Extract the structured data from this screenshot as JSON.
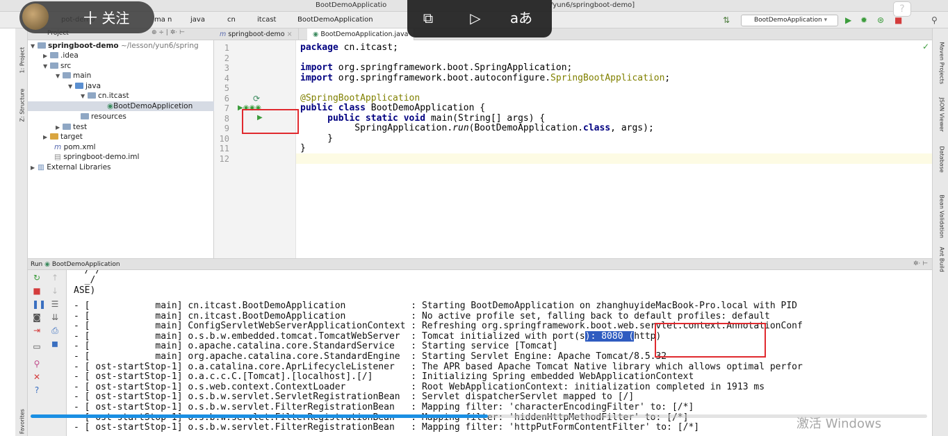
{
  "titlebar": {
    "file_tab": "BootDemoApplicatio",
    "path": "/yun6/springboot-demo]"
  },
  "navbar": {
    "crumbs": [
      "s",
      "pot-demo",
      "ma n",
      "java",
      "cn",
      "itcast",
      "BootDemoApplication"
    ],
    "run_config": "BootDemoApplication"
  },
  "overlay": {
    "follow_label": "十 关注",
    "help_label": "?"
  },
  "left_strip": {
    "project_tab": "1: Project",
    "structure_tab": "Z: Structure",
    "favorites_tab": "2: Favorites"
  },
  "right_strip": {
    "tabs": [
      "Maven Projects",
      "JSON Viewer",
      "Database",
      "Bean Validation",
      "Ant Build"
    ]
  },
  "project_panel": {
    "header": "Project",
    "tree": [
      {
        "label": "springboot-demo",
        "suffix": "~/lesson/yun6/spring",
        "indent": 0
      },
      {
        "label": ".idea",
        "indent": 1
      },
      {
        "label": "src",
        "indent": 1
      },
      {
        "label": "main",
        "indent": 2
      },
      {
        "label": "java",
        "indent": 3
      },
      {
        "label": "cn.itcast",
        "indent": 4
      },
      {
        "label": "BootDemoApplicetion",
        "indent": 5
      },
      {
        "label": "resources",
        "indent": 3
      },
      {
        "label": "test",
        "indent": 2
      },
      {
        "label": "target",
        "indent": 1
      },
      {
        "label": "pom.xml",
        "indent": 1
      },
      {
        "label": "springboot-demo.iml",
        "indent": 1
      },
      {
        "label": "External Libraries",
        "indent": 0
      }
    ]
  },
  "editor": {
    "tabs": [
      "springboot-demo",
      "BootDemoApplication.java"
    ],
    "line_numbers": [
      "1",
      "2",
      "3",
      "4",
      "5",
      "6",
      "7",
      "8",
      "9",
      "10",
      "11",
      "12"
    ],
    "lines": [
      {
        "kw": "package",
        "rest": " cn.itcast;"
      },
      {
        "kw": "",
        "rest": ""
      },
      {
        "kw": "import",
        "rest": " org.springframework.boot.SpringApplication;"
      },
      {
        "kw": "import",
        "rest": " org.springframework.boot.autoconfigure.",
        "ann": "SpringBootApplication",
        "tail": ";"
      },
      {
        "kw": "",
        "rest": ""
      },
      {
        "ann": "@SpringBootApplication"
      },
      {
        "kw": "public class",
        "rest": " BootDemoApplication {"
      },
      {
        "indent": "     ",
        "kw": "public static void",
        "rest": " main(String[] args) {"
      },
      {
        "indent": "          ",
        "rest": "SpringApplication.",
        "it": "run",
        "tail": "(BootDemoApplication.",
        "kw2": "class",
        "tail2": ", args);"
      },
      {
        "indent": "     ",
        "rest": "}"
      },
      {
        "rest": "}"
      },
      {
        "rest": ""
      }
    ]
  },
  "run_panel": {
    "header_run": "Run",
    "header_config": "BootDemoApplication",
    "pre_lines": [
      "  / /",
      "  _/",
      "ASE)"
    ],
    "log_rows": [
      {
        "dash": "- [",
        "thread": "           main]",
        "logger": "cn.itcast.BootDemoApplication           ",
        "msg": "Starting BootDemoApplication on zhanghuyideMacBook-Pro.local with PID"
      },
      {
        "dash": "- [",
        "thread": "           main]",
        "logger": "cn.itcast.BootDemoApplication           ",
        "msg": "No active profile set, falling back to default profiles: default"
      },
      {
        "dash": "- [",
        "thread": "           main]",
        "logger": "ConfigServletWebServerApplicationContext",
        "msg": "Refreshing org.springframework.boot.web.servlet.context.AnnotationConf"
      },
      {
        "dash": "- [",
        "thread": "           main]",
        "logger": "o.s.b.w.embedded.tomcat.TomcatWebServer ",
        "msg_pre": "Tomcat initialized with port(s",
        "msg_hl": "): 8080 (",
        "msg_post": "http)"
      },
      {
        "dash": "- [",
        "thread": "           main]",
        "logger": "o.apache.catalina.core.StandardService  ",
        "msg": "Starting service [Tomcat]"
      },
      {
        "dash": "- [",
        "thread": "           main]",
        "logger": "org.apache.catalina.core.StandardEngine ",
        "msg": "Starting Servlet Engine: Apache Tomcat/8.5.32"
      },
      {
        "dash": "- [",
        "thread": "ost-startStop-1]",
        "logger": "o.a.catalina.core.AprLifecycleListener  ",
        "msg": "The APR based Apache Tomcat Native library which allows optimal perfor"
      },
      {
        "dash": "- [",
        "thread": "ost-startStop-1]",
        "logger": "o.a.c.c.C.[Tomcat].[localhost].[/]      ",
        "msg": "Initializing Spring embedded WebApplicationContext"
      },
      {
        "dash": "- [",
        "thread": "ost-startStop-1]",
        "logger": "o.s.web.context.ContextLoader           ",
        "msg": "Root WebApplicationContext: initialization completed in 1913 ms"
      },
      {
        "dash": "- [",
        "thread": "ost-startStop-1]",
        "logger": "o.s.b.w.servlet.ServletRegistrationBean ",
        "msg": "Servlet dispatcherServlet mapped to [/]"
      },
      {
        "dash": "- [",
        "thread": "ost-startStop-1]",
        "logger": "o.s.b.w.servlet.FilterRegistrationBean  ",
        "msg": "Mapping filter: 'characterEncodingFilter' to: [/*]"
      },
      {
        "dash": "- [",
        "thread": "ost-startStop-1]",
        "logger": "o.s.b.w.servlet.FilterRegistrationBean  ",
        "msg": "Mapping filter: 'hiddenHttpMethodFilter' to: [/*]"
      },
      {
        "dash": "- [",
        "thread": "ost-startStop-1]",
        "logger": "o.s.b.w.servlet.FilterRegistrationBean  ",
        "msg": "Mapping filter: 'httpPutFormContentFilter' to: [/*]"
      }
    ]
  },
  "video": {
    "progress": 0.51,
    "watermark": "激活 Windows"
  }
}
